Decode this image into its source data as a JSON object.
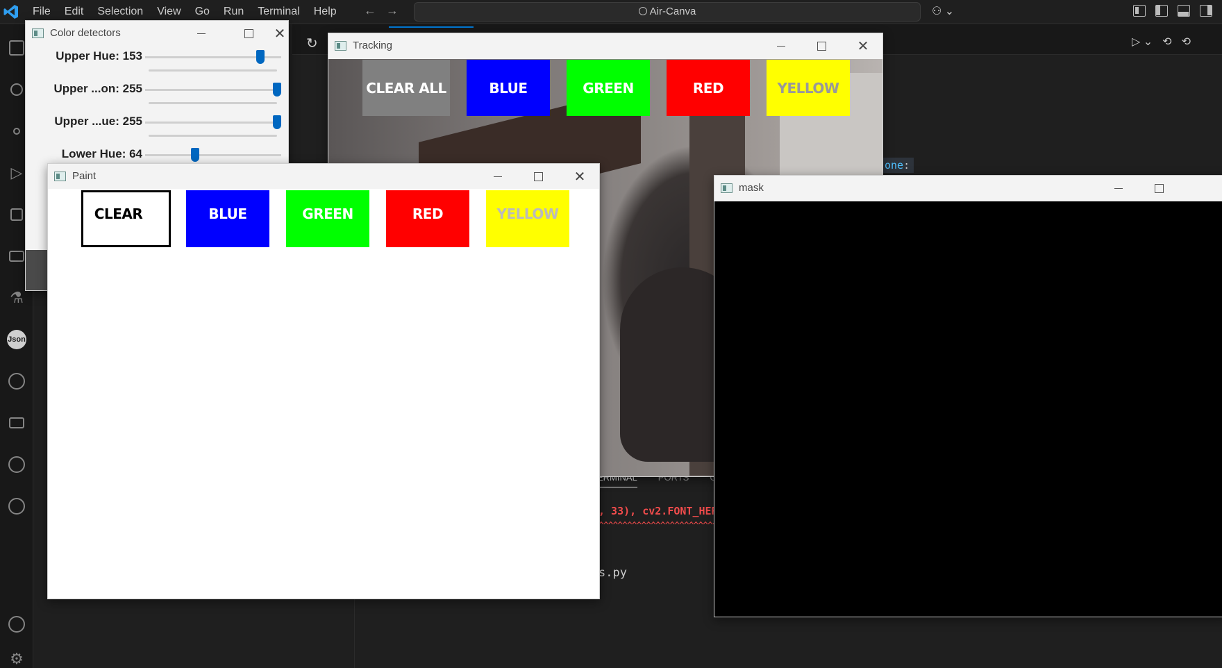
{
  "titlebar": {
    "menu": [
      "File",
      "Edit",
      "Selection",
      "View",
      "Go",
      "Run",
      "Terminal",
      "Help"
    ],
    "search": "Air-Canva",
    "nav_back": "←",
    "nav_forward": "→",
    "copilot": "⚇ ⌄"
  },
  "activity_bar": [
    "explorer-icon",
    "search-icon",
    "source-control-icon",
    "run-debug-icon",
    "extensions-icon",
    "remote-explorer-icon",
    "testing-icon",
    "json-icon",
    "github-icon",
    "folder-icon",
    "git-graph-icon",
    "git-lens-icon",
    "accounts-icon",
    "settings-icon"
  ],
  "json_badge": "Json",
  "editor": {
    "refresh": "↻",
    "run_controls": [
      "▷ ⌄",
      "⟲",
      "⟲"
    ],
    "code_fragment": "one",
    "code_colon": ":"
  },
  "panel": {
    "tabs": [
      "ERMINAL",
      "PORTS",
      "GI"
    ],
    "error_line": ", 33), cv2.FONT_HER",
    "error_marker": "^^^^^^^^^^^^^^^^^^^^^^^^^^^^^^",
    "file_fragment": "s.py"
  },
  "windows": {
    "detectors": {
      "title": "Color detectors",
      "trackbars": [
        {
          "label": "Upper Hue: 153",
          "value": 153,
          "max": 180
        },
        {
          "label": "Upper ...on: 255",
          "value": 255,
          "max": 255
        },
        {
          "label": "Upper ...ue: 255",
          "value": 255,
          "max": 255
        },
        {
          "label": "Lower Hue: 64",
          "value": 64,
          "max": 180
        }
      ]
    },
    "tracking": {
      "title": "Tracking",
      "buttons": [
        {
          "label": "CLEAR ALL",
          "bg": "#808080",
          "fg": "#ffffff"
        },
        {
          "label": "BLUE",
          "bg": "#0000ff",
          "fg": "#ffffff"
        },
        {
          "label": "GREEN",
          "bg": "#00ff00",
          "fg": "#ffffff"
        },
        {
          "label": "RED",
          "bg": "#ff0000",
          "fg": "#ffffff"
        },
        {
          "label": "YELLOW",
          "bg": "#ffff00",
          "fg": "#999999"
        }
      ]
    },
    "paint": {
      "title": "Paint",
      "buttons": [
        {
          "label": "CLEAR",
          "bg": "#ffffff",
          "fg": "#000000"
        },
        {
          "label": "BLUE",
          "bg": "#0000ff",
          "fg": "#ffffff"
        },
        {
          "label": "GREEN",
          "bg": "#00ff00",
          "fg": "#ffffff"
        },
        {
          "label": "RED",
          "bg": "#ff0000",
          "fg": "#ffffff"
        },
        {
          "label": "YELLOW",
          "bg": "#ffff00",
          "fg": "#bbbbbb"
        }
      ]
    },
    "mask": {
      "title": "mask"
    }
  }
}
